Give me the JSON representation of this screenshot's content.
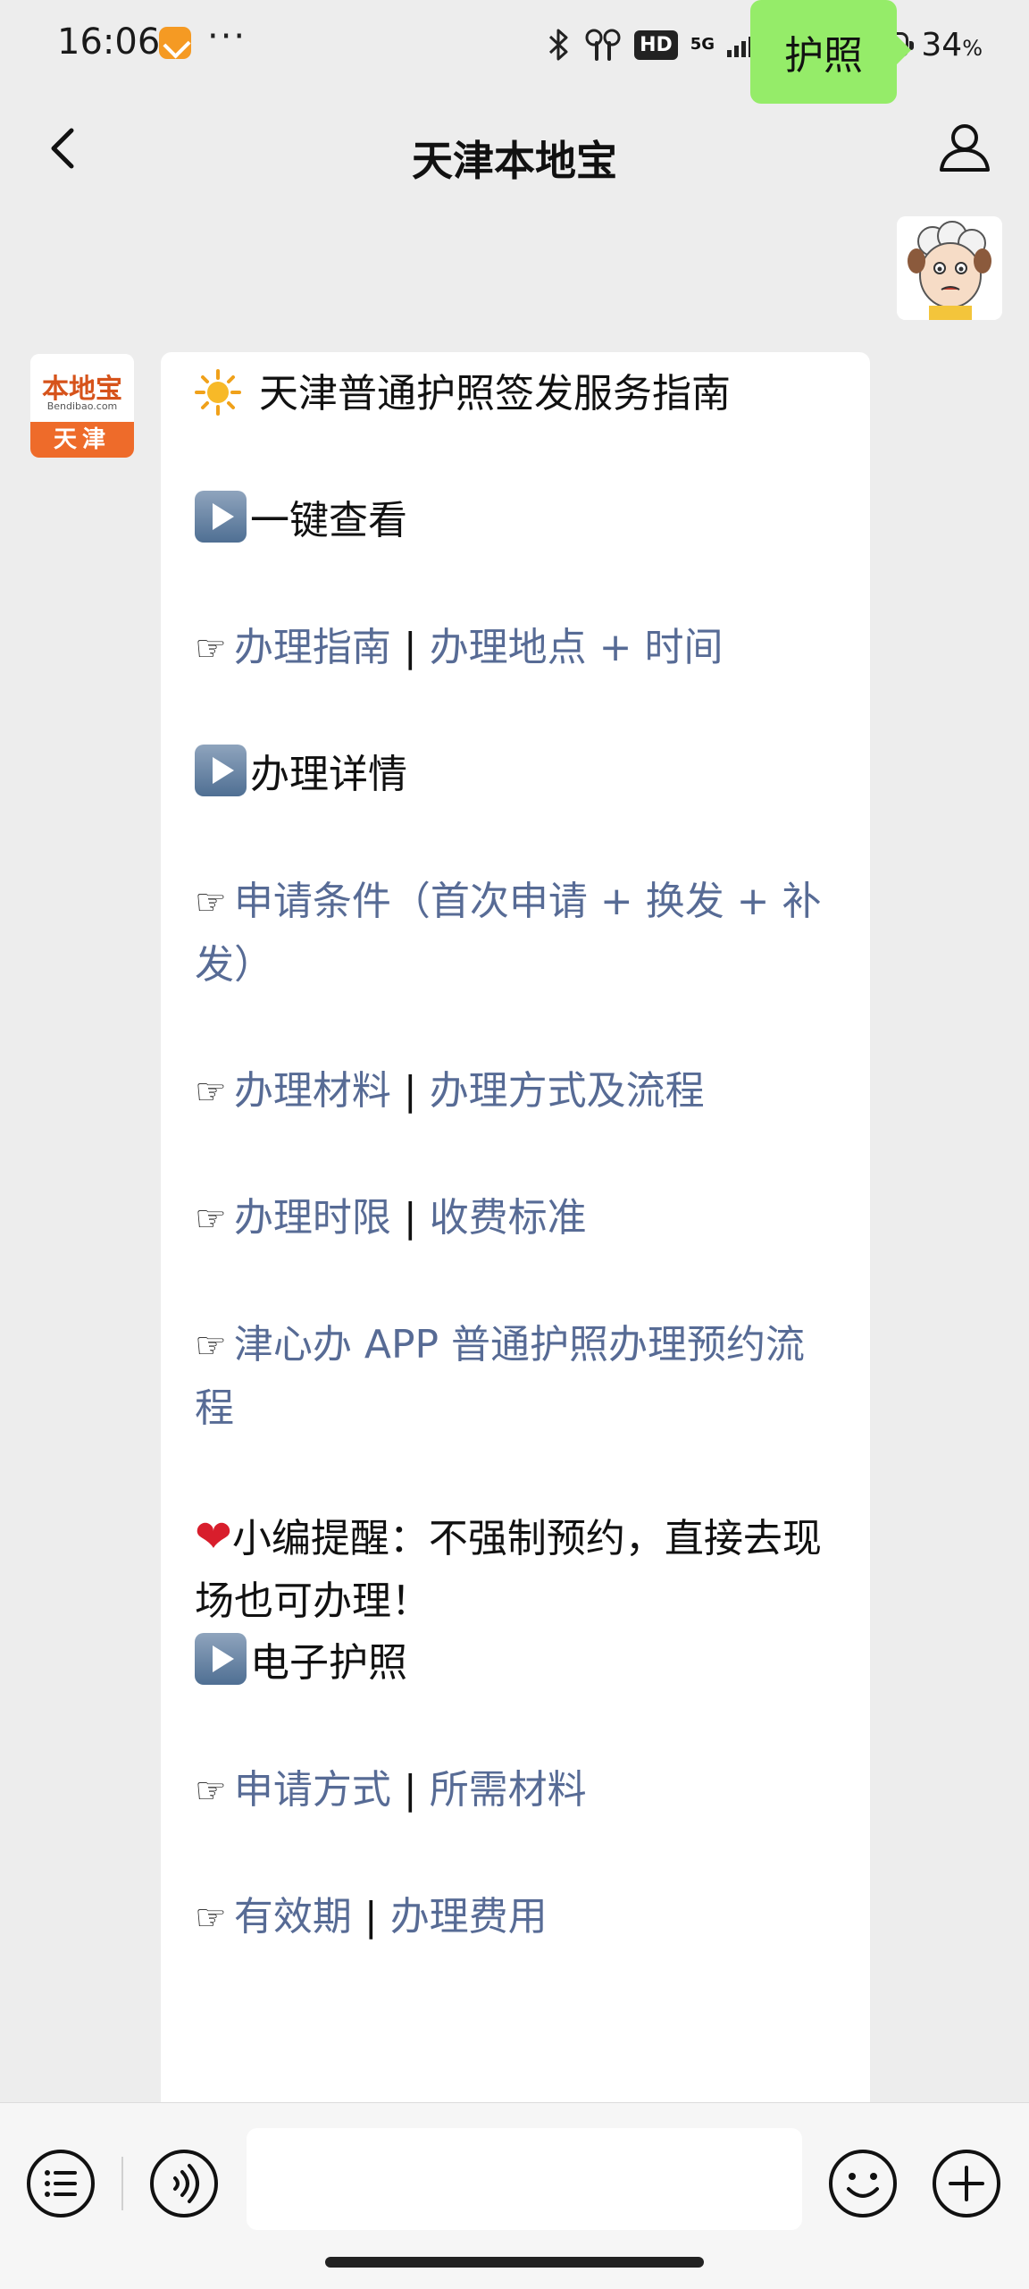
{
  "status_bar": {
    "time": "16:06",
    "more": "···",
    "hd_label": "HD",
    "net1": "5G",
    "net2": "5G",
    "battery_pct": "34",
    "battery_unit": "%",
    "battery_level": 0.34
  },
  "nav": {
    "title": "天津本地宝",
    "back_icon": "chevron-left-icon",
    "profile_icon": "person-icon"
  },
  "outgoing": {
    "text": "护照"
  },
  "bot": {
    "brand": "本地宝",
    "domain": "Bendibao.com",
    "city": "天津"
  },
  "card": {
    "title": "天津普通护照签发服务指南",
    "section1": "一键查看",
    "s1_links": [
      "办理指南",
      "办理地点 + 时间"
    ],
    "section2": "办理详情",
    "s2_link1": "申请条件（首次申请 + 换发 + 补发）",
    "s2_links2": [
      "办理材料",
      "办理方式及流程"
    ],
    "s2_links3": [
      "办理时限",
      "收费标准"
    ],
    "s2_link4": "津心办 APP 普通护照办理预约流程",
    "reminder": "小编提醒：不强制预约，直接去现场也可办理！",
    "section3": "电子护照",
    "s3_links1": [
      "申请方式",
      "所需材料"
    ],
    "s3_links2": [
      "有效期",
      "办理费用"
    ],
    "separator": "|",
    "pointer_glyph": "☞"
  },
  "input_bar": {
    "menu_icon": "menu-list-icon",
    "voice_icon": "voice-icon",
    "emoji_icon": "emoji-icon",
    "plus_icon": "plus-icon"
  },
  "colors": {
    "link": "#576b95",
    "bubble_out": "#95ec69",
    "background": "#ededed"
  }
}
